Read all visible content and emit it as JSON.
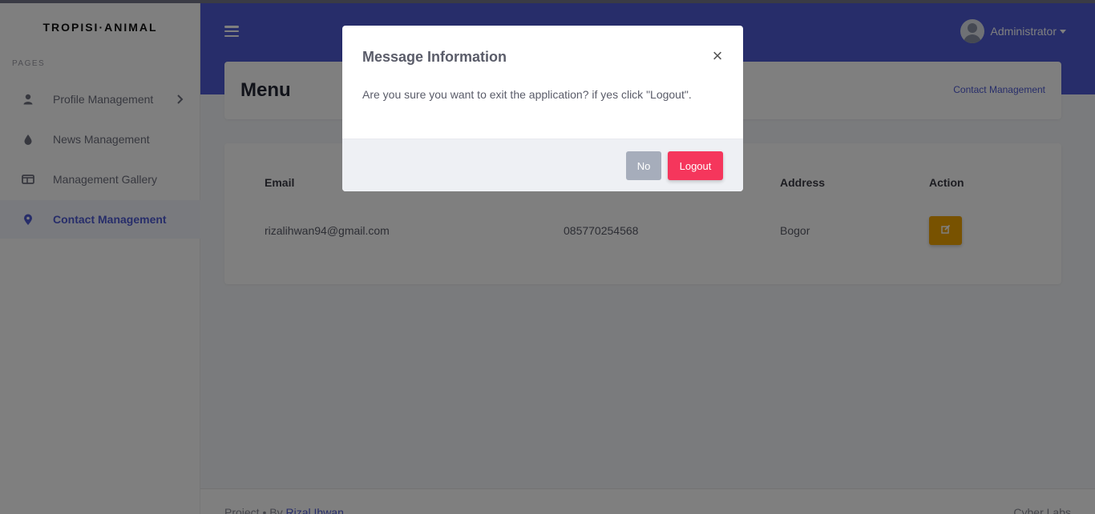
{
  "brand": "TROPISI·ANIMAL",
  "sidebar": {
    "heading": "PAGES",
    "items": [
      {
        "label": "Profile Management",
        "icon": "user-icon"
      },
      {
        "label": "News Management",
        "icon": "drop-icon"
      },
      {
        "label": "Management Gallery",
        "icon": "gallery-icon"
      },
      {
        "label": "Contact Management",
        "icon": "map-pin-icon",
        "active": true
      }
    ]
  },
  "topbar": {
    "user_name": "Administrator"
  },
  "page": {
    "title": "Menu",
    "breadcrumb": "Contact Management"
  },
  "table": {
    "headers": [
      "Email",
      "Address",
      "Action"
    ],
    "row": {
      "email": "rizalihwan94@gmail.com",
      "phone": "085770254568",
      "address": "Bogor"
    }
  },
  "footer": {
    "left_prefix": "Project",
    "left_sep": "•",
    "left_by": "By",
    "left_link": "Rizal Ihwan",
    "right": "Cyber Labs"
  },
  "modal": {
    "title": "Message Information",
    "close": "×",
    "body": "Are you sure you want to exit the application? if yes click \"Logout\".",
    "no_label": "No",
    "logout_label": "Logout"
  },
  "colors": {
    "primary": "#4e5bd4",
    "warning": "#f0a500",
    "danger": "#f5365c",
    "secondary": "#a6adbb"
  }
}
